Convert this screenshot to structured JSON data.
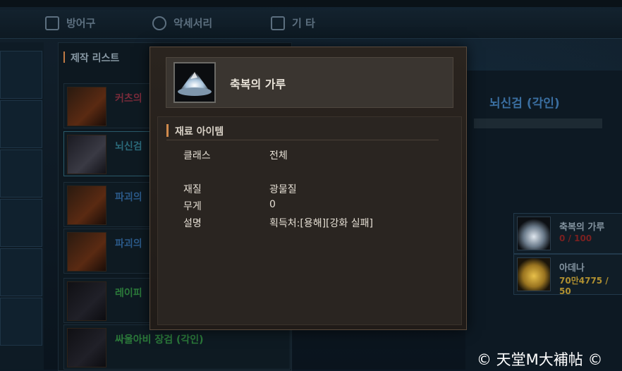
{
  "tabs": [
    {
      "label": "방어구",
      "icon": "shield-icon"
    },
    {
      "label": "악세서리",
      "icon": "ring-icon"
    },
    {
      "label": "기 타",
      "icon": "box-icon"
    }
  ],
  "craft_list": {
    "title": "제작 리스트",
    "rows": [
      {
        "label": "커츠의",
        "color": "#7a2b3a"
      },
      {
        "label": "뇌신검",
        "color": "#2b6a7a"
      },
      {
        "label": "파괴의",
        "color": "#2b5a8a"
      },
      {
        "label": "파괴의",
        "color": "#2b5a8a"
      },
      {
        "label": "레이피",
        "color": "#2b7a3a"
      },
      {
        "label": "싸울아비 장검 (각인)",
        "color": "#2b7a3a"
      }
    ]
  },
  "detail": {
    "title": "뇌신검 (각인)",
    "materials": [
      {
        "name": "축복의 가루",
        "value": "0 / 100",
        "value_color": "#7a2020"
      },
      {
        "name": "아데나",
        "value": "70만4775 / 50",
        "value_color": "#b09030"
      }
    ]
  },
  "popup": {
    "item_name": "축복의 가루",
    "section_title": "재료 아이템",
    "rows": [
      {
        "label": "클래스",
        "value": "전체"
      },
      {
        "label": "재질",
        "value": "광물질"
      },
      {
        "label": "무게",
        "value": "0"
      },
      {
        "label": "설명",
        "value": "획득처:[용해][강화 실패]"
      }
    ]
  },
  "watermark": "© 天堂M大補帖 ©"
}
